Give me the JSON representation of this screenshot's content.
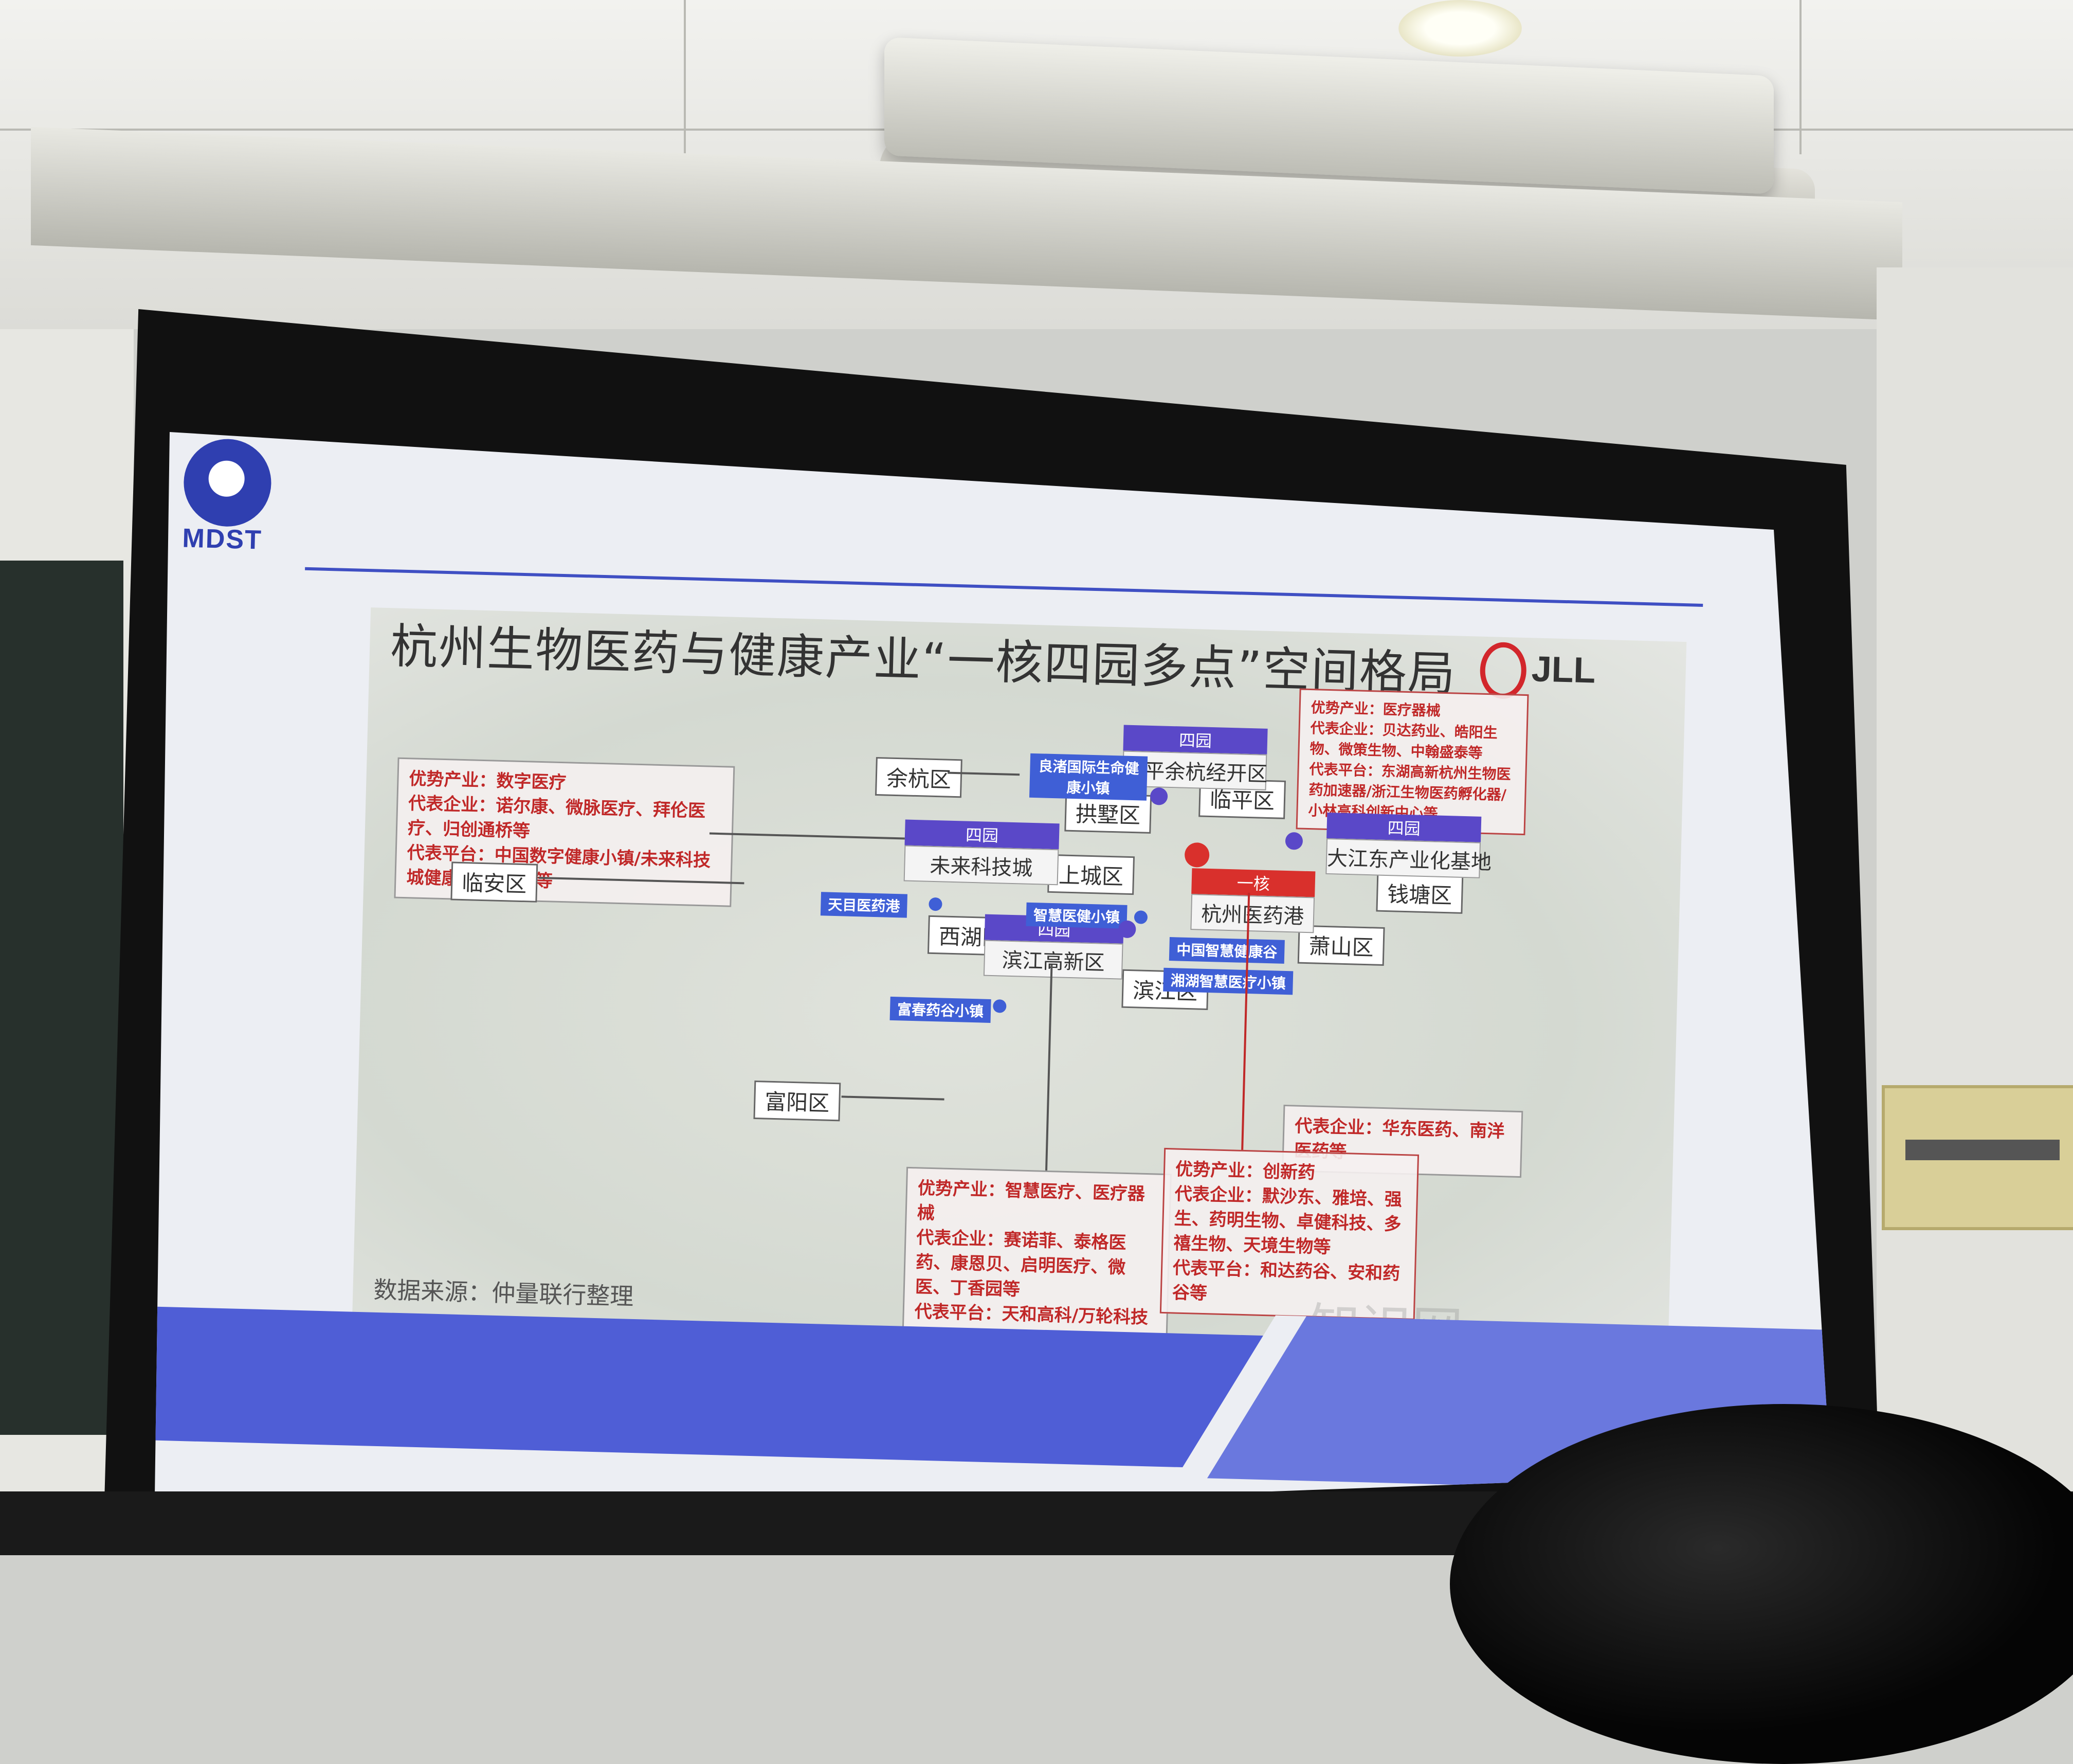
{
  "slide": {
    "logo_text": "MDST",
    "title": "杭州生物医药与健康产业“一核四园多点”空间格局",
    "jll_text": "JLL",
    "source": "数据来源：仲量联行整理",
    "watermark": "知识网"
  },
  "districts": [
    "余杭区",
    "临平区",
    "拱墅区",
    "上城区",
    "钱塘区",
    "临安区",
    "西湖区",
    "萧山区",
    "滨江区",
    "富阳区"
  ],
  "parks": [
    {
      "head": "四园",
      "name": "临平余杭经开区"
    },
    {
      "head": "四园",
      "name": "未来科技城"
    },
    {
      "head": "四园",
      "name": "大江东产业化基地"
    },
    {
      "head": "四园",
      "name": "滨江高新区"
    }
  ],
  "core": {
    "head": "一核",
    "name": "杭州医药港"
  },
  "towns": [
    "良渚国际生命健康小镇",
    "天目医药港",
    "智慧医健小镇",
    "中国智慧健康谷",
    "湘湖智慧医疗小镇",
    "富春药谷小镇"
  ],
  "info_boxes": {
    "northeast": "优势产业：医疗器械\n代表企业：贝达药业、皓阳生物、微策生物、中翰盛泰等\n代表平台：东湖高新杭州生物医药加速器/浙江生物医药孵化器/小林高科创新中心等",
    "northwest": "优势产业：数字医疗\n代表企业：诺尔康、微脉医疗、拜伦医疗、归创通桥等\n代表平台：中国数字健康小镇/未来科技城健康谷/海创园等",
    "east": "代表企业：华东医药、南洋医药等",
    "south_center": "优势产业：智慧医疗、医疗器械\n代表企业：赛诺菲、泰格医药、康恩贝、启明医疗、微医、丁香园等\n代表平台：天和高科/万轮科技园/中澳生物医药产业园等",
    "south_east": "优势产业：创新药\n代表企业：默沙东、雅培、强生、药明生物、卓健科技、多禧生物、天境生物等\n代表平台：和达药谷、安和药谷等"
  },
  "colors": {
    "accent_blue": "#3f4fc3",
    "park_purple": "#5a48c8",
    "core_red": "#d9302c",
    "info_red": "#c02828"
  }
}
